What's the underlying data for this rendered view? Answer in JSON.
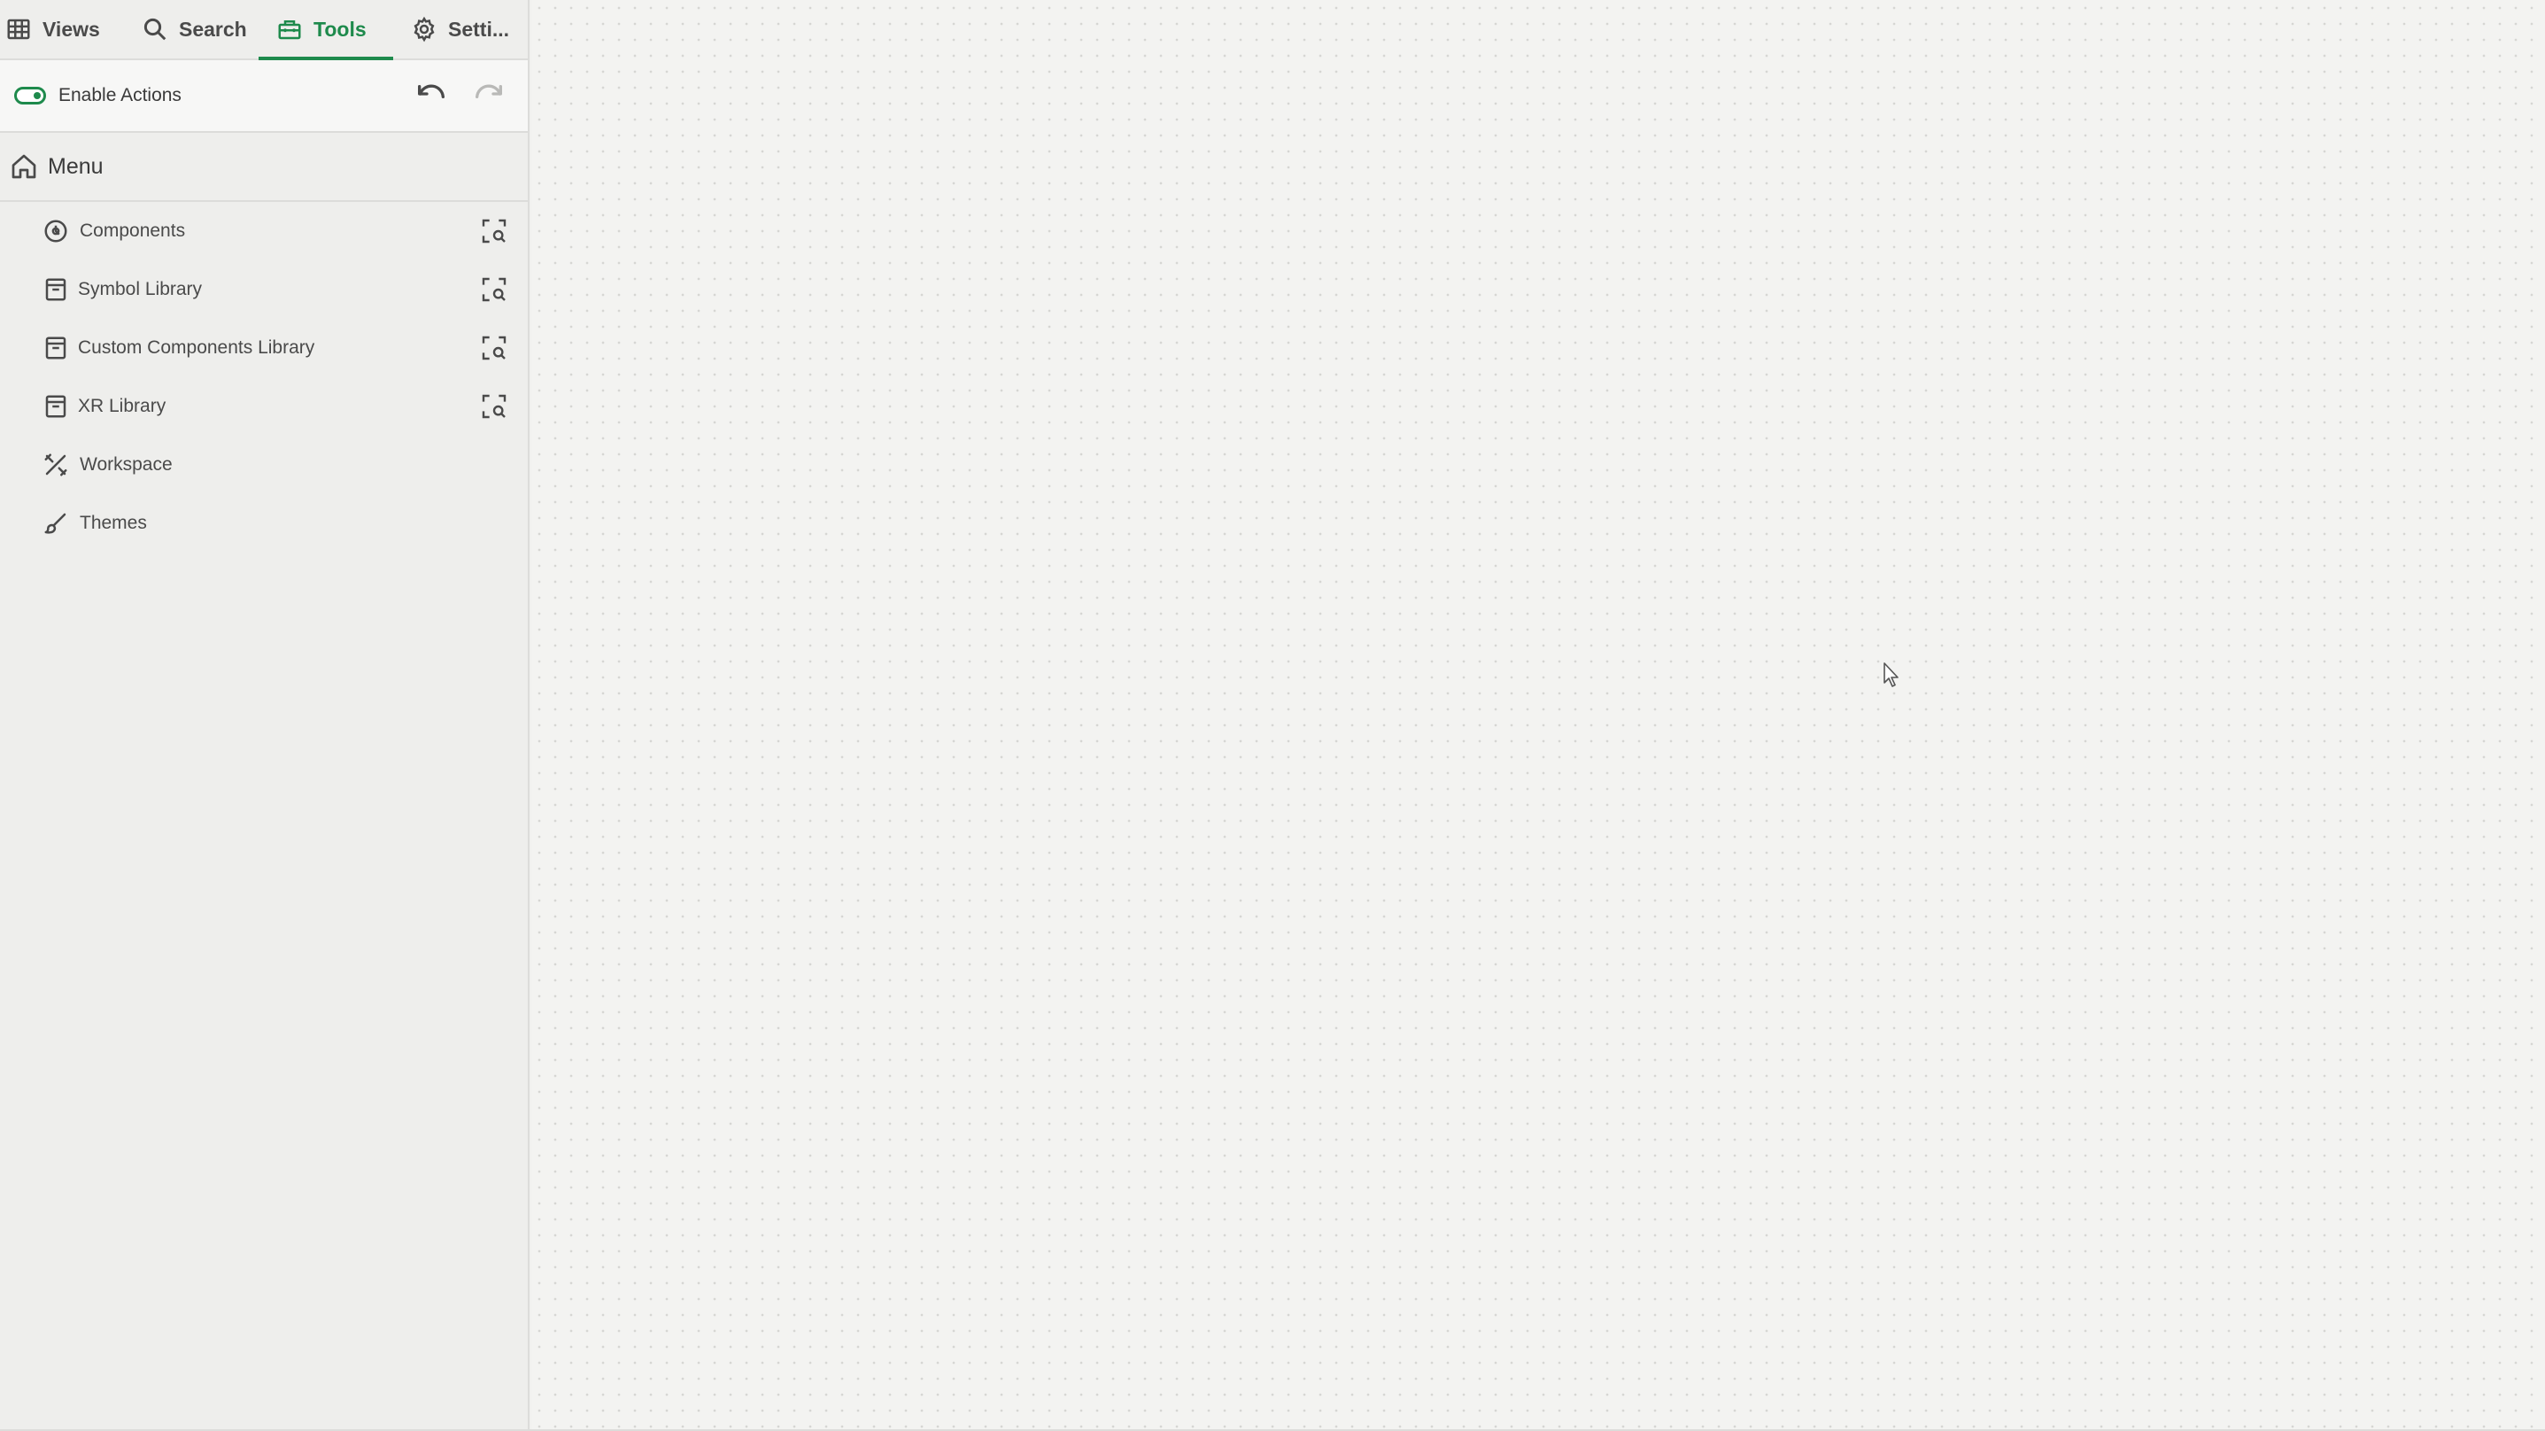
{
  "tabs": [
    {
      "label": "Views",
      "icon": "grid-icon"
    },
    {
      "label": "Search",
      "icon": "search-icon"
    },
    {
      "label": "Tools",
      "icon": "toolbox-icon",
      "active": true
    },
    {
      "label": "Setti...",
      "icon": "gear-icon"
    }
  ],
  "actions": {
    "toggle_label": "Enable Actions",
    "toggle_on": true
  },
  "menu": {
    "title": "Menu",
    "items": [
      {
        "label": "Components",
        "icon": "components-icon",
        "focus_icon": true
      },
      {
        "label": "Symbol Library",
        "icon": "library-icon",
        "focus_icon": true
      },
      {
        "label": "Custom Components Library",
        "icon": "library-icon",
        "focus_icon": true
      },
      {
        "label": "XR Library",
        "icon": "library-icon",
        "focus_icon": true
      },
      {
        "label": "Workspace",
        "icon": "workspace-tools-icon",
        "focus_icon": false
      },
      {
        "label": "Themes",
        "icon": "brush-icon",
        "focus_icon": false
      }
    ]
  },
  "colors": {
    "accent": "#1e8a4c",
    "sidebar_bg": "#eeeeec",
    "canvas_bg": "#f3f3f1"
  }
}
